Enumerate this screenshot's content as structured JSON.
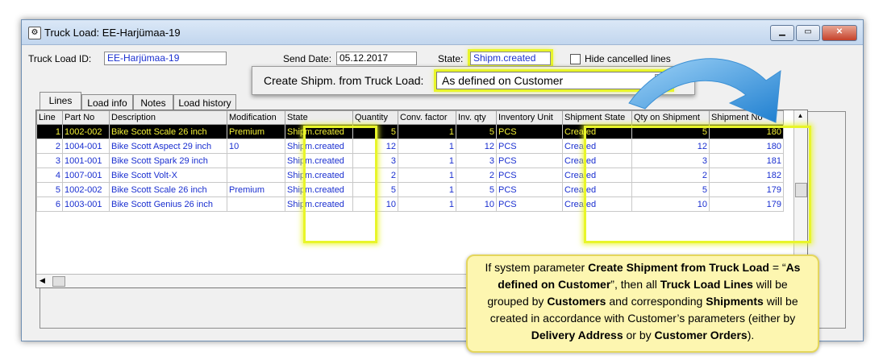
{
  "window": {
    "title": "Truck Load: EE-Harjümaa-19",
    "minimize_glyph": "▁",
    "maximize_glyph": "▭",
    "close_glyph": "✕"
  },
  "header": {
    "truck_load_id_label": "Truck Load ID:",
    "truck_load_id_value": "EE-Harjümaa-19",
    "send_date_label": "Send Date:",
    "send_date_value": "05.12.2017",
    "state_label": "State:",
    "state_value": "Shipm.created",
    "hide_cancelled_label": "Hide cancelled lines",
    "hide_cancelled_checked": false
  },
  "tabs": [
    "Lines",
    "Load info",
    "Notes",
    "Load history"
  ],
  "create_shipment": {
    "label": "Create Shipm. from Truck Load:",
    "value": "As defined on Customer"
  },
  "grid": {
    "columns": [
      "Line",
      "Part No",
      "Description",
      "Modification",
      "State",
      "Quantity",
      "Conv. factor",
      "Inv. qty",
      "Inventory Unit",
      "Shipment State",
      "Qty on Shipment",
      "Shipment No"
    ],
    "rows": [
      [
        "1",
        "1002-002",
        "Bike Scott Scale 26 inch",
        "Premium",
        "Shipm.created",
        "5",
        "1",
        "5",
        "PCS",
        "Created",
        "5",
        "180"
      ],
      [
        "2",
        "1004-001",
        "Bike Scott Aspect 29 inch",
        "10",
        "Shipm.created",
        "12",
        "1",
        "12",
        "PCS",
        "Created",
        "12",
        "180"
      ],
      [
        "3",
        "1001-001",
        "Bike Scott Spark 29 inch",
        "",
        "Shipm.created",
        "3",
        "1",
        "3",
        "PCS",
        "Created",
        "3",
        "181"
      ],
      [
        "4",
        "1007-001",
        "Bike Scott Volt-X",
        "",
        "Shipm.created",
        "2",
        "1",
        "2",
        "PCS",
        "Created",
        "2",
        "182"
      ],
      [
        "5",
        "1002-002",
        "Bike Scott Scale 26 inch",
        "Premium",
        "Shipm.created",
        "5",
        "1",
        "5",
        "PCS",
        "Created",
        "5",
        "179"
      ],
      [
        "6",
        "1003-001",
        "Bike Scott Genius 26 inch",
        "",
        "Shipm.created",
        "10",
        "1",
        "10",
        "PCS",
        "Created",
        "10",
        "179"
      ]
    ],
    "selected_row": 0
  },
  "callout": {
    "parts": [
      {
        "t": "If system parameter ",
        "b": false
      },
      {
        "t": "Create Shipment from Truck Load",
        "b": true
      },
      {
        "t": " = “",
        "b": false
      },
      {
        "t": "As defined on Customer",
        "b": true
      },
      {
        "t": "”, then all ",
        "b": false
      },
      {
        "t": "Truck Load Lines",
        "b": true
      },
      {
        "t": " will be grouped by ",
        "b": false
      },
      {
        "t": "Customers",
        "b": true
      },
      {
        "t": " and corresponding ",
        "b": false
      },
      {
        "t": "Shipments",
        "b": true
      },
      {
        "t": " will be created in accordance with Customer’s parameters (either by ",
        "b": false
      },
      {
        "t": "Delivery Address",
        "b": true
      },
      {
        "t": " or by ",
        "b": false
      },
      {
        "t": "Customer Orders",
        "b": true
      },
      {
        "t": ").",
        "b": false
      }
    ]
  },
  "colors": {
    "highlight": "#e8f52a",
    "callout_bg": "#fdf6b0",
    "arrow": "#3a9be0",
    "link_text": "#1a2fd0"
  }
}
